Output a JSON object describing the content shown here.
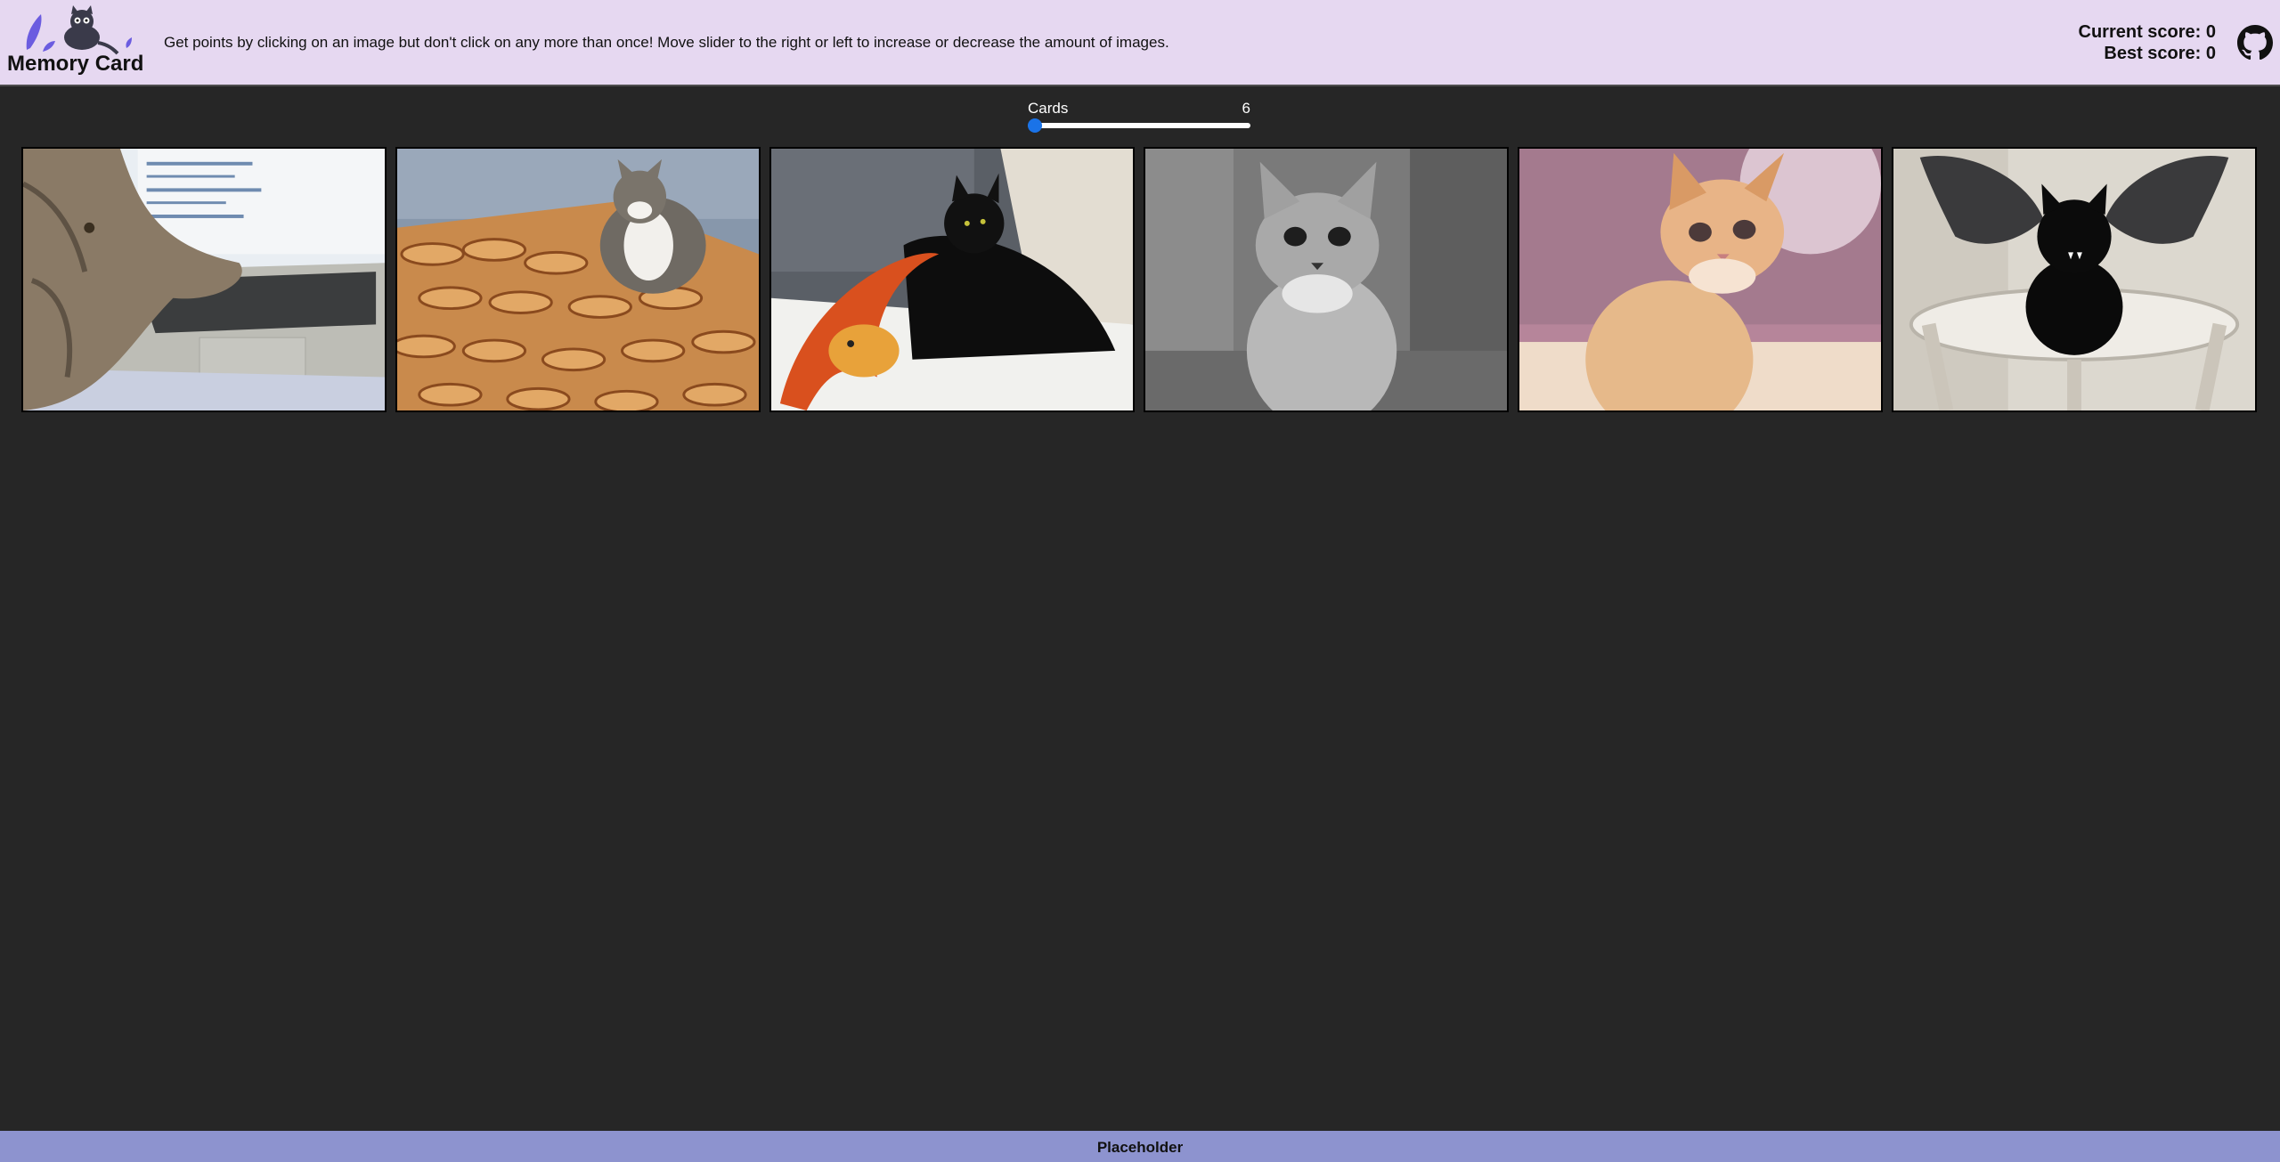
{
  "header": {
    "app_title": "Memory Card",
    "instructions": "Get points by clicking on an image but don't click on any more than once! Move slider to the right or left to increase or decrease the amount of images.",
    "current_score_label": "Current score: 0",
    "best_score_label": "Best score: 0",
    "github_icon": "github-icon",
    "logo_icon": "cat-logo-icon"
  },
  "slider": {
    "label": "Cards",
    "value": "6",
    "level": 0.0
  },
  "cards": [
    {
      "subject": "cat-on-laptop"
    },
    {
      "subject": "cat-with-hotdogs"
    },
    {
      "subject": "black-cat-with-toy-snake"
    },
    {
      "subject": "grayscale-fluffy-kitten"
    },
    {
      "subject": "orange-kitten"
    },
    {
      "subject": "black-cat-bat-wings"
    }
  ],
  "footer": {
    "text": "Placeholder"
  },
  "colors": {
    "header_bg": "#e6d8f1",
    "page_bg": "#262626",
    "footer_bg": "#8d93cf",
    "slider_accent": "#1a73e8"
  }
}
